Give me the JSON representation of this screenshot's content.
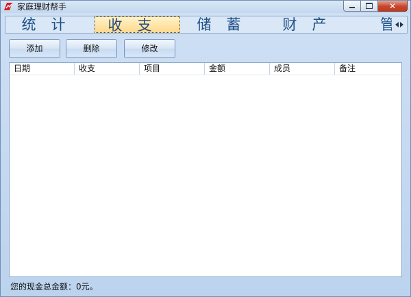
{
  "window": {
    "title": "家庭理财帮手",
    "close_glyph": "✕"
  },
  "tabs": [
    {
      "label": "统计",
      "active": false
    },
    {
      "label": "收支",
      "active": true
    },
    {
      "label": "储蓄",
      "active": false
    },
    {
      "label": "财产",
      "active": false
    },
    {
      "label": "管",
      "active": false
    }
  ],
  "toolbar": {
    "add_label": "添加",
    "delete_label": "删除",
    "edit_label": "修改"
  },
  "table": {
    "columns": [
      "日期",
      "收支",
      "项目",
      "金额",
      "成员",
      "备注"
    ],
    "rows": []
  },
  "status": {
    "text": "您的现金总金额：0元。"
  },
  "colors": {
    "tab_text": "#1f4f85",
    "active_tab_bg": "#ffd98e",
    "close_button": "#c7472c"
  }
}
